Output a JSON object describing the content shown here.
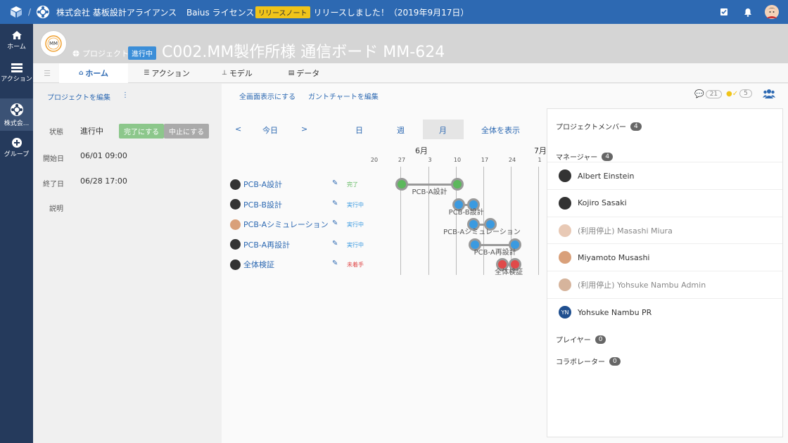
{
  "topbar": {
    "separator": "/",
    "company": "株式会社 基板設計アライアンス",
    "license": "Baius ライセンス",
    "release_badge": "リリースノート",
    "release_text": "リリースしました！（2019年9月17日）"
  },
  "nav": [
    {
      "label": "ホーム"
    },
    {
      "label": "アクション"
    },
    {
      "label": "株式会..."
    },
    {
      "label": "グループ"
    }
  ],
  "header": {
    "logo_text": "MM",
    "project_label": "プロジェクト",
    "status": "進行中",
    "title": "C002.MM製作所様 通信ボード MM-624"
  },
  "tabs": [
    {
      "label": "ホーム"
    },
    {
      "label": "アクション"
    },
    {
      "label": "モデル"
    },
    {
      "label": "データ"
    }
  ],
  "left": {
    "edit_link": "プロジェクトを編集",
    "more": "⋮",
    "status_label": "状態",
    "status_value": "進行中",
    "complete_btn": "完了にする",
    "stop_btn": "中止にする",
    "start_label": "開始日",
    "start_value": "06/01 09:00",
    "end_label": "終了日",
    "end_value": "06/28 17:00",
    "desc_label": "説明"
  },
  "main": {
    "fullscreen": "全画面表示にする",
    "edit_gantt": "ガントチャートを編集",
    "comments": "21",
    "checks": "5"
  },
  "gantt_nav": {
    "prev": "<",
    "today": "今日",
    "next": ">",
    "day": "日",
    "week": "週",
    "month": "月",
    "all": "全体を表示"
  },
  "timeline": {
    "months": [
      "6月",
      "7月"
    ],
    "ticks": [
      "20",
      "27",
      "3",
      "10",
      "17",
      "24",
      "1"
    ]
  },
  "tasks": [
    {
      "name": "PCB-A設計",
      "status": "完了",
      "color": "#5cb85c",
      "bar_label": "PCB-A設計",
      "start": 1,
      "end": 3
    },
    {
      "name": "PCB-B設計",
      "status": "実行中",
      "color": "#3b9ae0",
      "bar_label": "PCB-B設計",
      "start": 3.05,
      "end": 3.6
    },
    {
      "name": "PCB-Aシミュレーション",
      "status": "実行中",
      "color": "#3b9ae0",
      "bar_label": "PCB-Aシミュレーション",
      "start": 3.6,
      "end": 4.2
    },
    {
      "name": "PCB-A再設計",
      "status": "実行中",
      "color": "#3b9ae0",
      "bar_label": "PCB-A再設計",
      "start": 3.65,
      "end": 5.1
    },
    {
      "name": "全体検証",
      "status": "未着手",
      "color": "#e04a4a",
      "bar_label": "全体検証",
      "start": 4.65,
      "end": 5.1
    }
  ],
  "members": {
    "title": "プロジェクトメンバー",
    "count": "4",
    "manager_title": "マネージャー",
    "manager_count": "4",
    "list": [
      {
        "name": "Albert Einstein",
        "muted": false
      },
      {
        "name": "Kojiro Sasaki",
        "muted": false
      },
      {
        "name": "(利用停止) Masashi Miura",
        "muted": true
      },
      {
        "name": "Miyamoto Musashi",
        "muted": false
      },
      {
        "name": "(利用停止) Yohsuke Nambu Admin",
        "muted": true
      },
      {
        "name": "Yohsuke Nambu PR",
        "muted": false,
        "initials": "YN"
      }
    ],
    "player_title": "プレイヤー",
    "player_count": "0",
    "collab_title": "コラボレーター",
    "collab_count": "0"
  }
}
